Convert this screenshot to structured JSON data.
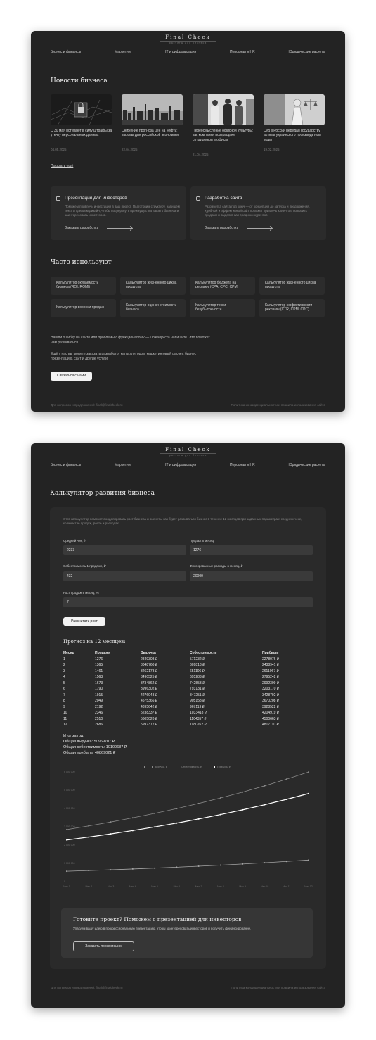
{
  "brand": {
    "name": "Final Check",
    "tagline": "расчеты для бизнеса"
  },
  "nav": [
    "Бизнес и финансы",
    "Маркетинг",
    "IT и цифровизация",
    "Персонал и HR",
    "Юридические расчеты"
  ],
  "news": {
    "heading": "Новости бизнеса",
    "items": [
      {
        "title": "С 30 мая вступают в силу штрафы за утечку персональных данных",
        "date": "04.05.2025"
      },
      {
        "title": "Снижение прогноза цен на нефть: вызовы для российской экономики",
        "date": "22.04.2025"
      },
      {
        "title": "Переосмысление офисной культуры: как компании возвращают сотрудников в офисы",
        "date": "21.04.2025"
      },
      {
        "title": "Суд в России передал государству активы украинского производителя воды",
        "date": "19.02.2025"
      }
    ],
    "show_more": "Показать ещё"
  },
  "services": [
    {
      "icon": "presentation-icon",
      "title": "Презентация для инвесторов",
      "desc": "Поможем привлечь инвестиции в ваш проект. Подготовим структуру, напишем текст и сделаем дизайн, чтобы подчеркнуть преимущества вашего бизнеса и заинтересовать инвесторов.",
      "link": "Заказать разработку"
    },
    {
      "icon": "website-icon",
      "title": "Разработка сайта",
      "desc": "Разработка сайта под ключ — от концепции до запуска и продвижения. Удобный и эффективный сайт поможет привлечь клиентов, повысить продажи и выделит вас среди конкурентов.",
      "link": "Заказать разработку"
    }
  ],
  "popular": {
    "heading": "Часто используют",
    "tools": [
      "Калькулятор окупаемости бизнеса (ROI, ROMI)",
      "Калькулятор жизненного цикла продукта",
      "Калькулятор бюджета на рекламу (CPA, CPC, CPM)",
      "Калькулятор жизненного цикла продукта",
      "Калькулятор воронки продаж",
      "Калькулятор оценки стоимости бизнеса",
      "Калькулятор точки безубыточности",
      "Калькулятор эффективности рекламы (CTR, CPM, CPC)"
    ]
  },
  "feedback": {
    "text1": "Нашли ошибку на сайте или проблемы с функционалом? — Пожалуйста напишите. Это поможет нам развиваться.",
    "text2": "Ещё у нас вы можете заказать разработку калькуляторов, маркетинговый расчет, бизнес презентацию, сайт и другие услуги.",
    "button": "Связаться с нами"
  },
  "footer": {
    "left": "Для вопросов и предложений: final@finalcheck.ru",
    "right": "Политика конфиденциальности и правила использования сайта"
  },
  "calculator": {
    "heading": "Калькулятор развития бизнеса",
    "intro": "Этот калькулятор поможет смоделировать рост бизнеса и оценить, как будет развиваться бизнес в течение 12 месяцев при заданных параметрах: средним чеке, количестве продаж, росте и расходах.",
    "fields": {
      "avg_check": {
        "label": "Средний чек, ₽",
        "value": "2233"
      },
      "sales": {
        "label": "Продаж в месяц",
        "value": "1276"
      },
      "cost": {
        "label": "Себестоимость 1 продажи, ₽",
        "value": "432"
      },
      "fixed": {
        "label": "Фиксированные расходы в месяц, ₽",
        "value": "20000"
      },
      "growth": {
        "label": "Рост продаж в месяц, %",
        "value": "7"
      }
    },
    "button": "Рассчитать рост",
    "forecast_title": "Прогноз на 12 месяцев:",
    "columns": [
      "Месяц",
      "Продажи",
      "Выручка",
      "Себестоимость",
      "Прибыль"
    ],
    "rows": [
      [
        "1",
        "1276",
        "2849308 ₽",
        "571232 ₽",
        "2278076 ₽"
      ],
      [
        "2",
        "1365",
        "3048760 ₽",
        "609818 ₽",
        "2438941 ₽"
      ],
      [
        "3",
        "1461",
        "3262173 ₽",
        "651106 ₽",
        "2611067 ₽"
      ],
      [
        "4",
        "1563",
        "3490525 ₽",
        "695283 ₽",
        "2795242 ₽"
      ],
      [
        "5",
        "1673",
        "3734862 ₽",
        "742553 ₽",
        "2992309 ₽"
      ],
      [
        "6",
        "1790",
        "3996302 ₽",
        "793131 ₽",
        "3203170 ₽"
      ],
      [
        "7",
        "1915",
        "4276043 ₽",
        "847251 ₽",
        "3428792 ₽"
      ],
      [
        "8",
        "2049",
        "4575366 ₽",
        "905158 ₽",
        "3670208 ₽"
      ],
      [
        "9",
        "2192",
        "4895642 ₽",
        "967119 ₽",
        "3928522 ₽"
      ],
      [
        "10",
        "2346",
        "5238337 ₽",
        "1033418 ₽",
        "4204919 ₽"
      ],
      [
        "11",
        "2510",
        "5605020 ₽",
        "1104357 ₽",
        "4500663 ₽"
      ],
      [
        "12",
        "2686",
        "5997372 ₽",
        "1180262 ₽",
        "4817110 ₽"
      ]
    ],
    "totals_title": "Итог за год:",
    "totals": [
      "Общая выручка: 50969707 ₽",
      "Общая себестоимость: 10100687 ₽",
      "Общая прибыль: 40869021 ₽"
    ]
  },
  "chart_data": {
    "type": "line",
    "x": [
      "Мес 1",
      "Мес 2",
      "Мес 3",
      "Мес 4",
      "Мес 5",
      "Мес 6",
      "Мес 7",
      "Мес 8",
      "Мес 9",
      "Мес 10",
      "Мес 11",
      "Мес 12"
    ],
    "series": [
      {
        "name": "Выручка, ₽",
        "color": "#8a8a8a",
        "values": [
          2849308,
          3048760,
          3262173,
          3490525,
          3734862,
          3996302,
          4276043,
          4575366,
          4895642,
          5238337,
          5605020,
          5997372
        ]
      },
      {
        "name": "Себестоимость, ₽",
        "color": "#a6a6a6",
        "values": [
          571232,
          609818,
          651106,
          695283,
          742553,
          793131,
          847251,
          905158,
          967119,
          1033418,
          1104357,
          1180262
        ]
      },
      {
        "name": "Прибыль, ₽",
        "color": "#ffffff",
        "values": [
          2278076,
          2438941,
          2611067,
          2795242,
          2992309,
          3203170,
          3428792,
          3670208,
          3928522,
          4204919,
          4500663,
          4817110
        ]
      }
    ],
    "yticks": [
      "0",
      "1 000 000",
      "2 000 000",
      "3 000 000",
      "4 000 000",
      "5 000 000",
      "6 000 000"
    ],
    "ylim": [
      0,
      6000000
    ],
    "legend": "top",
    "grid": false
  },
  "cta": {
    "title": "Готовите проект? Поможем с презентацией для инвесторов",
    "desc": "Упакуем вашу идею в профессиональную презентацию, чтобы заинтересовать инвесторов и получить финансирование.",
    "button": "Заказать презентацию"
  }
}
